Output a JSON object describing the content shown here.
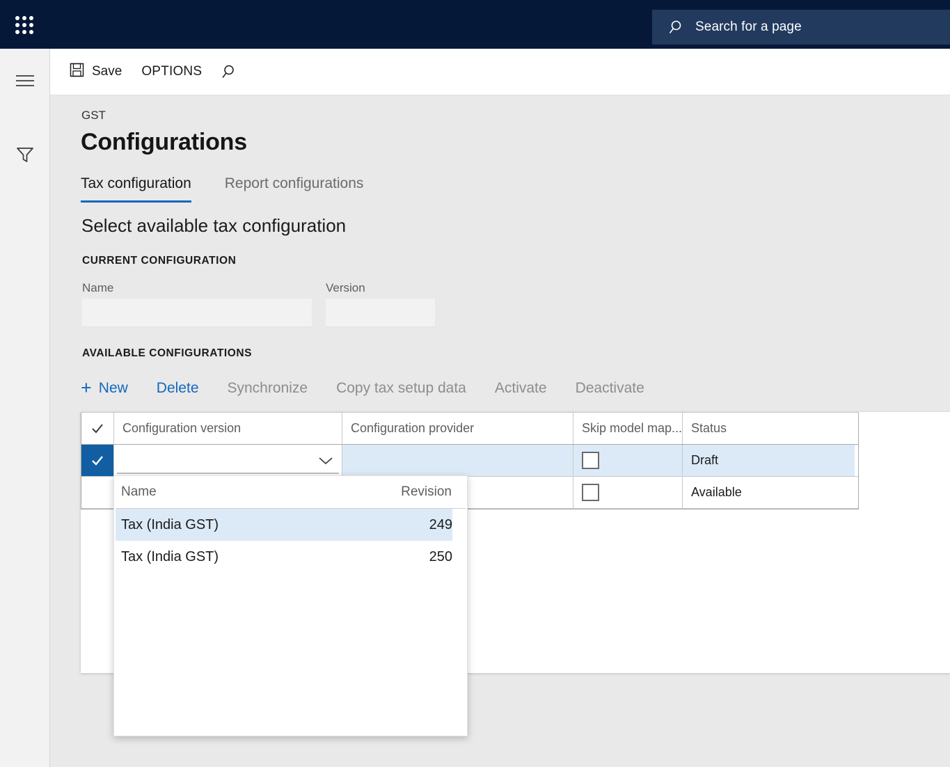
{
  "topbar": {
    "waffle_icon": "app-launcher-icon",
    "search": {
      "icon": "search-icon",
      "placeholder": "Search for a page",
      "value": ""
    },
    "background_color": "#061838",
    "search_background_color": "#223a5e"
  },
  "left_rail": {
    "items": [
      {
        "icon": "hamburger-menu-icon",
        "name": "navigation-pane-toggle"
      },
      {
        "icon": "filter-funnel-icon",
        "name": "filter-pane-toggle"
      }
    ]
  },
  "command_bar": {
    "save_label": "Save",
    "save_icon": "save-disk-icon",
    "options_label": "OPTIONS",
    "search_icon": "search-icon"
  },
  "page": {
    "breadcrumb": "GST",
    "title": "Configurations",
    "tabs": [
      {
        "label": "Tax configuration",
        "active": true
      },
      {
        "label": "Report configurations",
        "active": false
      }
    ],
    "section_title": "Select available tax configuration",
    "accent_color": "#1367bf"
  },
  "current_configuration": {
    "group_label": "CURRENT CONFIGURATION",
    "fields": [
      {
        "label": "Name",
        "value": "",
        "placeholder": ""
      },
      {
        "label": "Version",
        "value": "",
        "placeholder": ""
      }
    ]
  },
  "available_configurations": {
    "group_label": "AVAILABLE CONFIGURATIONS",
    "actions": [
      {
        "label": "New",
        "icon": "plus-icon",
        "enabled": true
      },
      {
        "label": "Delete",
        "enabled": true
      },
      {
        "label": "Synchronize",
        "enabled": false
      },
      {
        "label": "Copy tax setup data",
        "enabled": false
      },
      {
        "label": "Activate",
        "enabled": false
      },
      {
        "label": "Deactivate",
        "enabled": false
      }
    ],
    "grid": {
      "columns": [
        "Configuration version",
        "Configuration provider",
        "Skip model map...",
        "Status"
      ],
      "select_all_icon": "checkmark-icon",
      "rows": [
        {
          "selected": true,
          "row_check_icon": "checkmark-icon",
          "configuration_version": "",
          "configuration_provider": "",
          "skip_model_mapping": false,
          "status": "Draft",
          "editing": true,
          "chevron_icon": "chevron-down-icon"
        },
        {
          "selected": false,
          "configuration_version": "",
          "configuration_provider": "",
          "skip_model_mapping": false,
          "status": "Available",
          "editing": false
        }
      ]
    }
  },
  "dropdown": {
    "columns": {
      "name": "Name",
      "revision": "Revision"
    },
    "items": [
      {
        "name": "Tax (India GST)",
        "revision": "249",
        "highlighted": true
      },
      {
        "name": "Tax (India GST)",
        "revision": "250",
        "highlighted": false
      }
    ],
    "highlight_color": "#dceaf7"
  }
}
